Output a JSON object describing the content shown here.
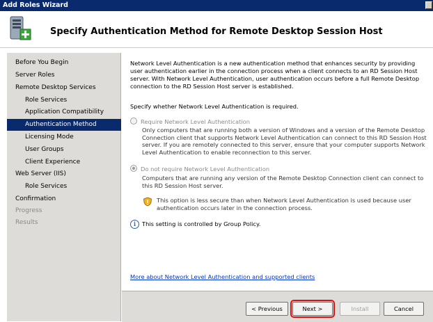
{
  "window": {
    "title": "Add Roles Wizard"
  },
  "header": {
    "title": "Specify Authentication Method for Remote Desktop Session Host",
    "icon": "server-roles-icon"
  },
  "nav": {
    "items": [
      {
        "label": "Before You Begin",
        "level": "top",
        "state": "normal"
      },
      {
        "label": "Server Roles",
        "level": "top",
        "state": "normal"
      },
      {
        "label": "Remote Desktop Services",
        "level": "top",
        "state": "normal"
      },
      {
        "label": "Role Services",
        "level": "sub",
        "state": "normal"
      },
      {
        "label": "Application Compatibility",
        "level": "sub",
        "state": "normal"
      },
      {
        "label": "Authentication Method",
        "level": "sub",
        "state": "selected"
      },
      {
        "label": "Licensing Mode",
        "level": "sub",
        "state": "normal"
      },
      {
        "label": "User Groups",
        "level": "sub",
        "state": "normal"
      },
      {
        "label": "Client Experience",
        "level": "sub",
        "state": "normal"
      },
      {
        "label": "Web Server (IIS)",
        "level": "top",
        "state": "normal"
      },
      {
        "label": "Role Services",
        "level": "sub",
        "state": "normal"
      },
      {
        "label": "Confirmation",
        "level": "top",
        "state": "normal"
      },
      {
        "label": "Progress",
        "level": "top",
        "state": "disabled"
      },
      {
        "label": "Results",
        "level": "top",
        "state": "disabled"
      }
    ]
  },
  "content": {
    "intro": "Network Level Authentication is a new authentication method that enhances security by providing user authentication earlier in the connection process when a client connects to an RD Session Host server. With Network Level Authentication, user authentication occurs before a full Remote Desktop connection to the RD Session Host server is established.",
    "question": "Specify whether Network Level Authentication is required.",
    "option_require": {
      "label": "Require Network Level Authentication",
      "description": "Only computers that are running both a version of Windows and a version of the Remote Desktop Connection client that supports Network Level Authentication can connect to this RD Session Host server. If you are remotely connected to this server, ensure that your computer supports Network Level Authentication to enable reconnection to this server.",
      "checked": false
    },
    "option_not_require": {
      "label": "Do not require Network Level Authentication",
      "description": "Computers that are running any version of the Remote Desktop Connection client can connect to this RD Session Host server.",
      "checked": true,
      "warning": "This option is less secure than when Network Level Authentication is used because user authentication occurs later in the connection process."
    },
    "policy_note": "This setting is controlled by Group Policy.",
    "more_link": "More about Network Level Authentication and supported clients"
  },
  "footer": {
    "previous_label": "< Previous",
    "next_label": "Next >",
    "install_label": "Install",
    "cancel_label": "Cancel"
  },
  "colors": {
    "title_bar": "#0a2a6e",
    "selection": "#0a2a6e",
    "nav_bg": "#dedcd8",
    "link": "#0033cc",
    "highlight": "#e01010"
  }
}
